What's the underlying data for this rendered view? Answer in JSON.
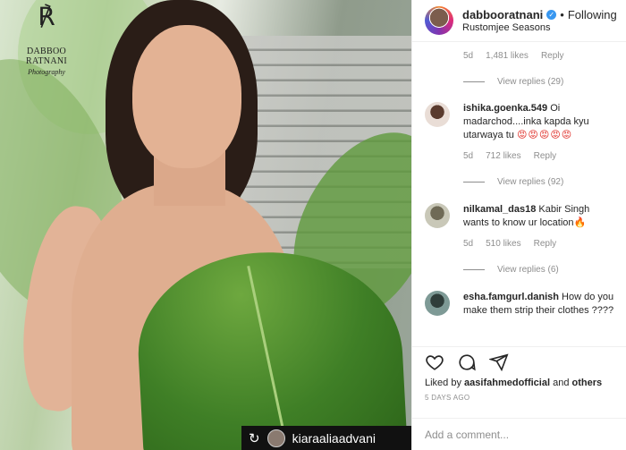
{
  "post": {
    "brand_monogram": "℟",
    "brand_name": "DABBOO RATNANI",
    "brand_sub": "Photography",
    "repost_icon": "↻",
    "tagged_user": "kiaraaliaadvani"
  },
  "header": {
    "username": "dabbooratnani",
    "verified_mark": "✓",
    "separator": "•",
    "follow_label": "Following",
    "location": "Rustomjee Seasons"
  },
  "comments": {
    "top_meta": {
      "time": "5d",
      "likes": "1,481 likes",
      "reply": "Reply"
    },
    "top_view_replies": "View replies (29)",
    "items": [
      {
        "user": "ishika.goenka.549",
        "text": "Oi madarchod....inka kapda kyu utarwaya tu",
        "emoji": "😡😡😡😡😡",
        "time": "5d",
        "likes": "712 likes",
        "reply": "Reply",
        "view_replies": "View replies (92)"
      },
      {
        "user": "nilkamal_das18",
        "text": "Kabir Singh wants to know ur location",
        "emoji": "🔥",
        "time": "5d",
        "likes": "510 likes",
        "reply": "Reply",
        "view_replies": "View replies (6)"
      },
      {
        "user": "esha.famgurl.danish",
        "text": "How do you make them strip their clothes ????"
      }
    ]
  },
  "actions": {
    "icons": [
      "heart-icon",
      "comment-icon",
      "share-icon"
    ],
    "liked_prefix": "Liked by",
    "liked_user": "aasifahmedofficial",
    "liked_and": "and",
    "liked_others": "others",
    "timestamp": "5 DAYS AGO"
  },
  "add_comment": {
    "placeholder": "Add a comment..."
  },
  "colors": {
    "verified": "#3897f0",
    "muted": "#8e8e8e",
    "text": "#262626"
  }
}
